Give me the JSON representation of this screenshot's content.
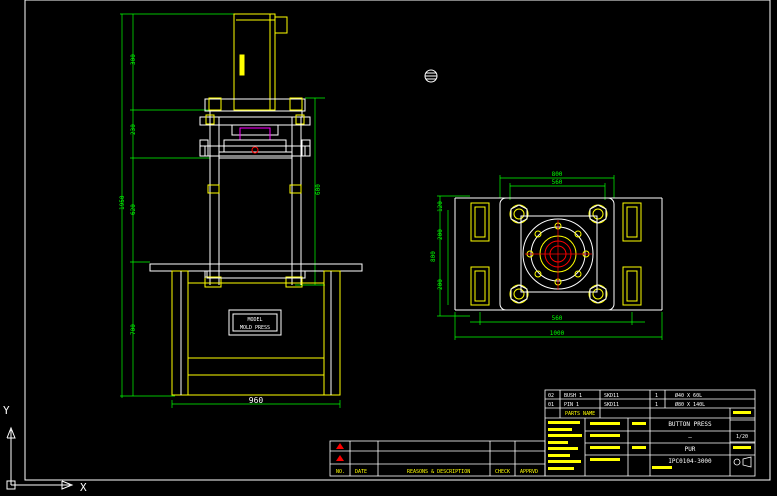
{
  "axes": {
    "x_label": "X",
    "y_label": "Y"
  },
  "elevation": {
    "width_dim": "960",
    "nameplate": {
      "line1": "MODEL",
      "line2": "MOLD PRESS"
    }
  },
  "plan": {
    "top_dim_outer": "800",
    "top_dim_inner": "560",
    "bottom_dim_inner": "560",
    "bottom_dim_outer": "1000"
  },
  "revision_block": {
    "headers": {
      "no": "NO.",
      "date": "DATE",
      "reasons": "REASONS & DESCRIPTION",
      "check": "CHECK",
      "apprvd": "APPRVD"
    }
  },
  "parts_list": [
    {
      "no": "02",
      "name": "BUSH 1",
      "material": "SKD11",
      "qty": "1",
      "spec": "Ø40 X 60L"
    },
    {
      "no": "01",
      "name": "PIN 1",
      "material": "SKD11",
      "qty": "1",
      "spec": "Ø80 X 140L"
    }
  ],
  "title_block": {
    "part_name_header": "PARTS NAME",
    "title": "BUTTON PRESS",
    "material": "PUR",
    "drawing_no": "IPC0104-3000",
    "scale": "1/20",
    "dash": "—"
  },
  "colors": {
    "background": "#000000",
    "outline": "#ffffff",
    "parts": "#ffff00",
    "dimensions": "#00ff00",
    "centerline": "#ff0000",
    "highlight": "#ff00ff",
    "table": "#00ffff"
  }
}
